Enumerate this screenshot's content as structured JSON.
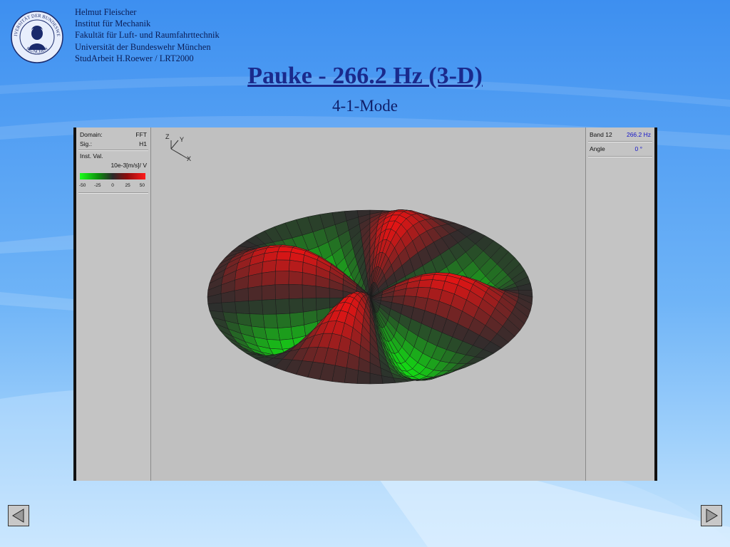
{
  "header": {
    "author": "Helmut Fleischer",
    "institute": "Institut für Mechanik",
    "faculty": "Fakultät für Luft- und Raumfahrttechnik",
    "university": "Universität der Bundeswehr München",
    "project": "StudArbeit H.Roewer / LRT2000"
  },
  "logo": {
    "top_text": "UNIVERSITÄT DER BUNDESWEHR",
    "bottom_text": "MÜNCHEN"
  },
  "slide": {
    "title": "Pauke - 266.2 Hz (3-D)",
    "subtitle": "4-1-Mode"
  },
  "left_panel": {
    "domain_label": "Domain:",
    "domain_value": "FFT",
    "sig_label": "Sig.:",
    "sig_value": "H1",
    "inst_label": "Inst. Val.",
    "unit": "10e-3[m/s]/ V",
    "colorbar_ticks": [
      "-50",
      "-25",
      "0",
      "25",
      "50"
    ]
  },
  "right_panel": {
    "band_label": "Band 12",
    "band_value": "266.2 Hz",
    "angle_label": "Angle",
    "angle_value": "0 °"
  },
  "axes": {
    "z": "Z",
    "y": "Y",
    "x": "X"
  },
  "colors": {
    "title": "#1a2a8c",
    "band_value": "#1515c8",
    "positive": "#ff1a1a",
    "negative": "#1aff1a",
    "node": "#2a2a2a"
  },
  "mode": {
    "circumferential_order": 4,
    "radial_order": 1
  },
  "icons": {
    "prev": "triangle-left-icon",
    "next": "triangle-right-icon"
  }
}
